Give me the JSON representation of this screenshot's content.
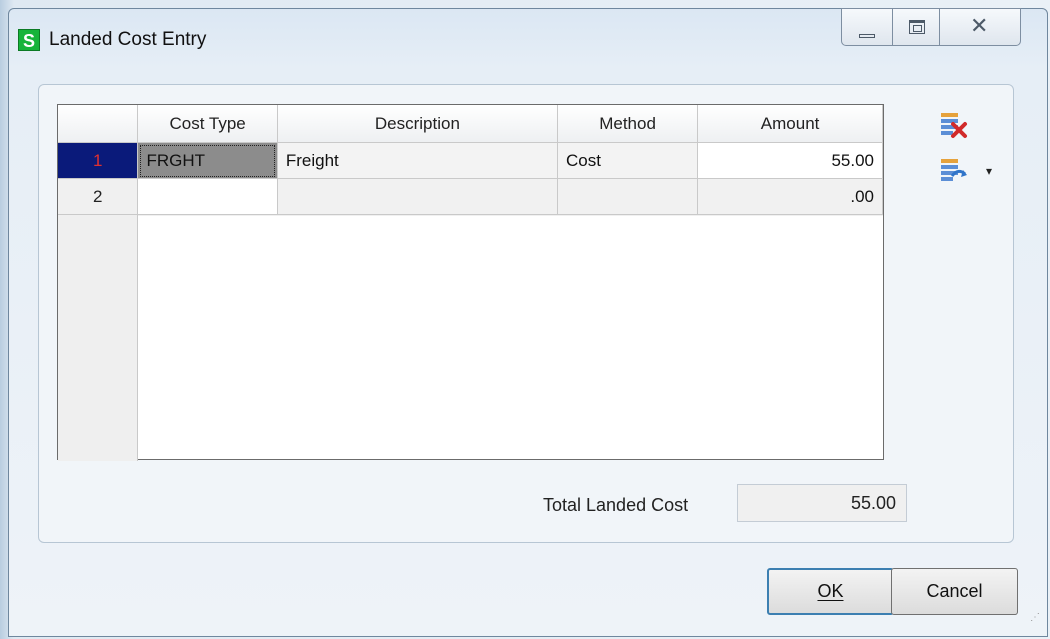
{
  "window": {
    "title": "Landed Cost Entry",
    "app_icon_letter": "S",
    "close_glyph": "✕"
  },
  "grid": {
    "columns": [
      "Cost Type",
      "Description",
      "Method",
      "Amount"
    ],
    "rows": [
      {
        "num": "1",
        "cost_type": "FRGHT",
        "description": "Freight",
        "method": "Cost",
        "amount": "55.00"
      },
      {
        "num": "2",
        "cost_type": "",
        "description": "",
        "method": "",
        "amount": ".00"
      }
    ]
  },
  "toolbar": {
    "delete_icon": "delete-row-icon",
    "more_icon": "more-options-icon",
    "chevron": "▾"
  },
  "total": {
    "label": "Total Landed Cost",
    "value": "55.00"
  },
  "buttons": {
    "ok": "OK",
    "cancel": "Cancel"
  },
  "colors": {
    "selected_row_header": "#0a1a7a",
    "row_number_selected": "#e03030",
    "app_icon": "#16b43a"
  }
}
